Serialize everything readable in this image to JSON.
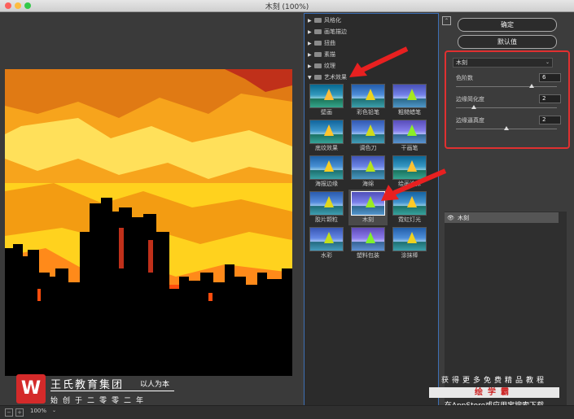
{
  "window": {
    "title": "木刻 (100%)"
  },
  "categories": [
    {
      "label": "风格化",
      "expanded": false
    },
    {
      "label": "画笔描边",
      "expanded": false
    },
    {
      "label": "扭曲",
      "expanded": false
    },
    {
      "label": "素描",
      "expanded": false
    },
    {
      "label": "纹理",
      "expanded": false
    },
    {
      "label": "艺术效果",
      "expanded": true
    }
  ],
  "filters": [
    {
      "label": "壁画"
    },
    {
      "label": "彩色铅笔"
    },
    {
      "label": "粗糙蜡笔"
    },
    {
      "label": "底纹效果"
    },
    {
      "label": "调色刀"
    },
    {
      "label": "干画笔"
    },
    {
      "label": "海报边缘"
    },
    {
      "label": "海绵"
    },
    {
      "label": "绘画涂抹"
    },
    {
      "label": "胶片颗粒"
    },
    {
      "label": "木刻"
    },
    {
      "label": "霓虹灯光"
    },
    {
      "label": "水彩"
    },
    {
      "label": "塑料包装"
    },
    {
      "label": "涂抹棒"
    }
  ],
  "selected_filter": "木刻",
  "buttons": {
    "ok": "确定",
    "default": "默认值"
  },
  "settings": {
    "filter_select": "木刻",
    "params": [
      {
        "label": "色阶数",
        "value": "6",
        "fraction": 0.75
      },
      {
        "label": "边缘简化度",
        "value": "2",
        "fraction": 0.18
      },
      {
        "label": "边缘逼真度",
        "value": "2",
        "fraction": 0.5
      }
    ]
  },
  "layers": [
    {
      "name": "木刻",
      "visible": true
    }
  ],
  "status": {
    "zoom": "100%",
    "zoom_out": "−",
    "zoom_in": "+"
  },
  "watermark": {
    "logo": "W",
    "name": "王氏教育集团",
    "slogan": "以人为本",
    "subtitle": "始创于二零零二年"
  },
  "promo": {
    "line1": "获得更多免费精品教程",
    "brand": "绘学霸",
    "line3": "在AppStore或应用宝搜索下载"
  },
  "colors": {
    "accent_red": "#e03030",
    "browser_border": "#3d6fb5"
  }
}
